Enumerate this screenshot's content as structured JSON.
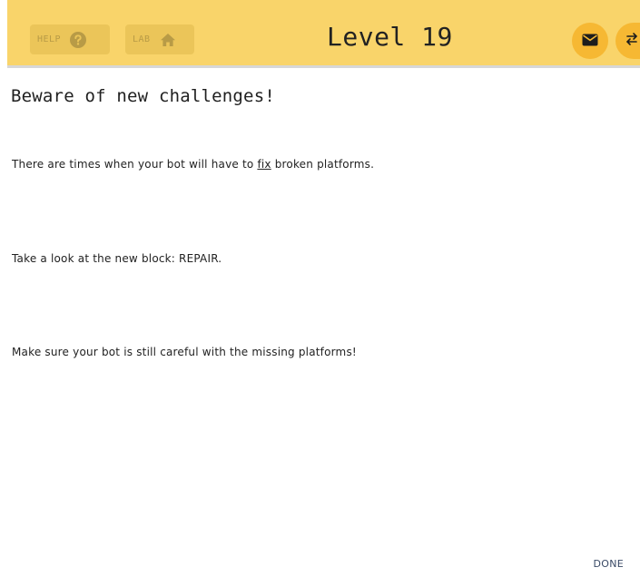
{
  "header": {
    "help_label": "HELP",
    "lab_label": "LAB",
    "title": "Level 19",
    "colors": {
      "bar": "#f9d46a",
      "pill": "#ebc559",
      "circle": "#f6b833"
    },
    "icons": [
      "question-circle-icon",
      "home-icon",
      "mail-icon",
      "swap-arrows-icon"
    ]
  },
  "content": {
    "heading": "Beware of new challenges!",
    "p1_before": "There are times when your bot will have to ",
    "p1_underline": "fix",
    "p1_after": " broken platforms.",
    "p2": "Take a look at the new block: REPAIR.",
    "p3": "Make sure your bot is still careful with the missing platforms!"
  },
  "footer": {
    "done_label": "DONE"
  }
}
